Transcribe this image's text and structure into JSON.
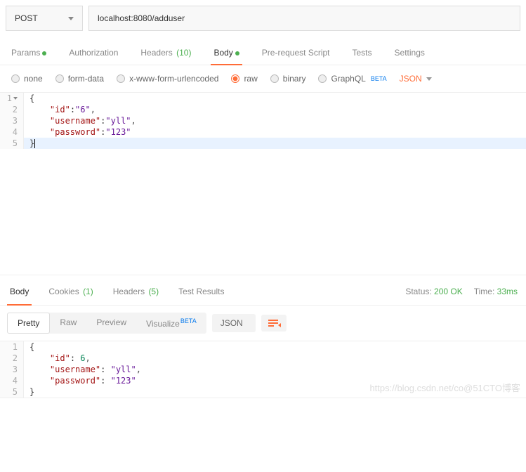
{
  "request": {
    "method": "POST",
    "url": "localhost:8080/adduser"
  },
  "tabs": {
    "params": "Params",
    "auth": "Authorization",
    "headers_label": "Headers",
    "headers_count": "(10)",
    "body": "Body",
    "prereq": "Pre-request Script",
    "tests": "Tests",
    "settings": "Settings"
  },
  "body_types": {
    "none": "none",
    "form": "form-data",
    "urlenc": "x-www-form-urlencoded",
    "raw": "raw",
    "binary": "binary",
    "graphql": "GraphQL",
    "beta": "BETA",
    "content": "JSON"
  },
  "req_code": {
    "l1": "{",
    "l2a": "\"id\"",
    "l2b": ":",
    "l2c": "\"6\"",
    "l2d": ",",
    "l3a": "\"username\"",
    "l3b": ":",
    "l3c": "\"yll\"",
    "l3d": ",",
    "l4a": "\"password\"",
    "l4b": ":",
    "l4c": "\"123\"",
    "l5": "}"
  },
  "resp_tabs": {
    "body": "Body",
    "cookies": "Cookies",
    "cookies_count": "(1)",
    "headers": "Headers",
    "headers_count": "(5)",
    "tests": "Test Results"
  },
  "status": {
    "label": "Status:",
    "code": "200 OK",
    "time_label": "Time:",
    "time": "33ms"
  },
  "view": {
    "pretty": "Pretty",
    "raw": "Raw",
    "preview": "Preview",
    "visualize": "Visualize",
    "beta": "BETA",
    "type": "JSON"
  },
  "resp_code": {
    "l1": "{",
    "l2a": "\"id\"",
    "l2b": ": ",
    "l2c": "6",
    "l2d": ",",
    "l3a": "\"username\"",
    "l3b": ": ",
    "l3c": "\"yll\"",
    "l3d": ",",
    "l4a": "\"password\"",
    "l4b": ": ",
    "l4c": "\"123\"",
    "l5": "}"
  },
  "watermark": "https://blog.csdn.net/co@51CTO博客"
}
